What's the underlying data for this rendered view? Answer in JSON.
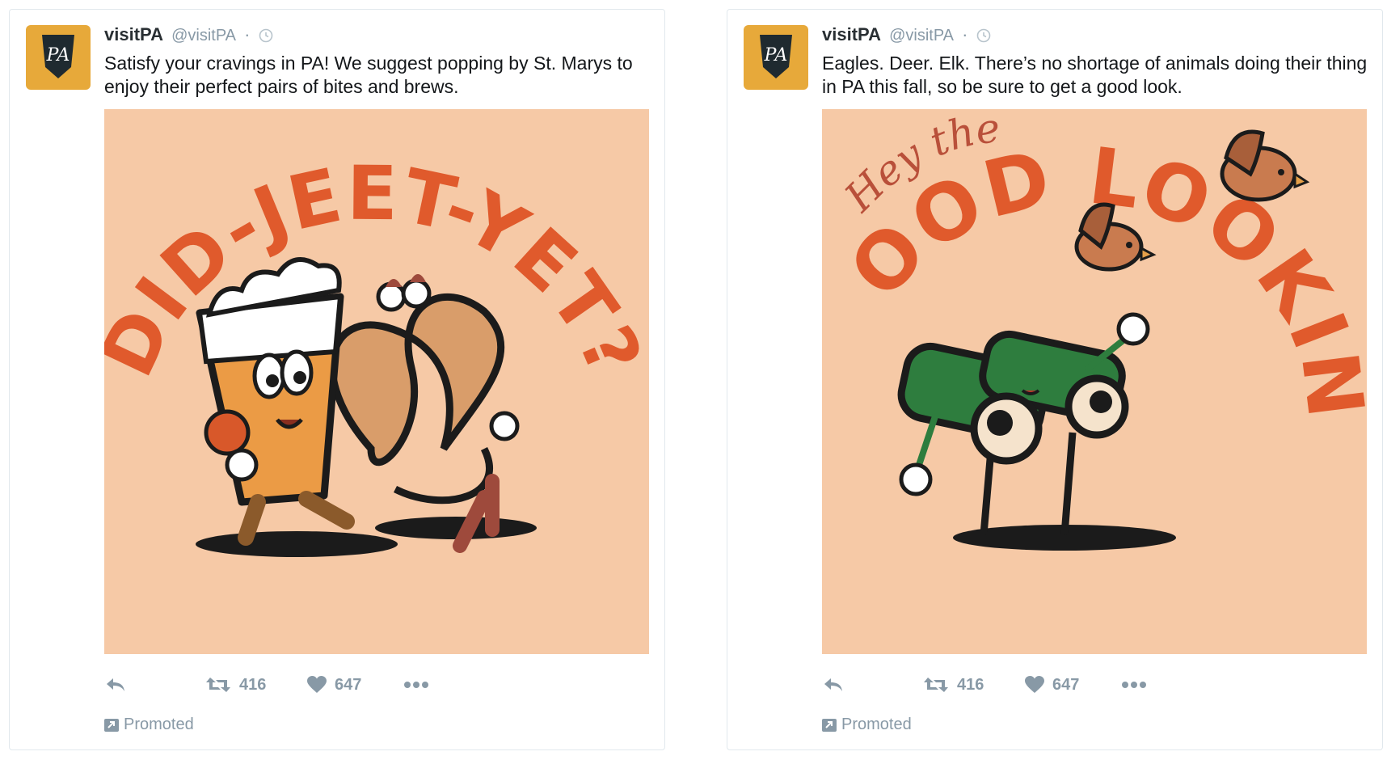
{
  "tweets": [
    {
      "name": "visitPA",
      "handle": "@visitPA",
      "separator": "·",
      "avatar_text": "PA",
      "text": "Satisfy your cravings in PA! We suggest popping by St. Marys to enjoy their perfect pairs of bites and brews.",
      "media_headline": "DID-JEET-YET?",
      "retweets": "416",
      "likes": "647",
      "promoted": "Promoted",
      "icons": [
        "reply-icon",
        "retweet-icon",
        "heart-icon",
        "more-icon",
        "promoted-icon",
        "clock-icon"
      ]
    },
    {
      "name": "visitPA",
      "handle": "@visitPA",
      "separator": "·",
      "avatar_text": "PA",
      "text": "Eagles. Deer. Elk. There’s no shortage of animals doing their thing in PA this fall, so be sure to get a good look.",
      "media_script": "Hey there",
      "media_headline": "GOOD LOOKIN'",
      "retweets": "416",
      "likes": "647",
      "promoted": "Promoted",
      "icons": [
        "reply-icon",
        "retweet-icon",
        "heart-icon",
        "more-icon",
        "promoted-icon",
        "clock-icon"
      ]
    }
  ],
  "colors": {
    "media_bg": "#f6c9a6",
    "headline": "#e05a2c",
    "avatar_bg": "#e7a93a",
    "muted": "#8899a6",
    "binocular_green": "#2e7d3e"
  }
}
